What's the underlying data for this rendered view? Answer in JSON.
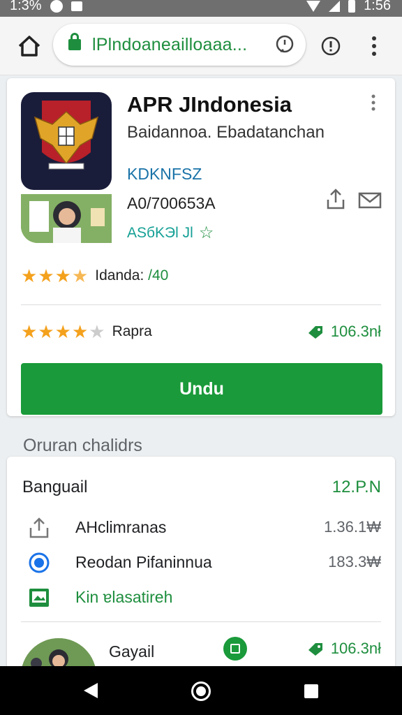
{
  "status_bar": {
    "time_left": "1:3%",
    "time_right": "1:56"
  },
  "browser": {
    "url": "lPlndoaneailloaaa...",
    "icons": [
      "home-icon",
      "lock-icon",
      "status-icon",
      "info-icon",
      "more-vert-icon"
    ]
  },
  "app": {
    "title": "APR JIndonesia",
    "developer": "Baidannoa. Ebadatanchan",
    "category": "KDKNFSZ",
    "version": "A0/700653A",
    "tags": "ASбKЭl Jl",
    "rating_label": "Idanda:",
    "rating_value": "/40",
    "rating_stars": 3.5,
    "rating2_label": "Rapra",
    "rating2_stars": 4.5,
    "size": "106.3nł",
    "install_label": "Undu"
  },
  "section": {
    "heading": "Oruran chalidrs",
    "list_title": "Banguail",
    "list_time": "12.P.N",
    "rows": [
      {
        "label": "AHclimranas",
        "amount": "1.36.1₩",
        "icon": "share-icon"
      },
      {
        "label": "Reodan Pifaninnua",
        "amount": "183.3₩",
        "icon": "radio-icon"
      },
      {
        "label": "Kin ɐlasatireh",
        "amount": "",
        "icon": "image-icon"
      }
    ],
    "bottom_name": "Gayail",
    "bottom_size": "106.3nł"
  },
  "colors": {
    "accent_green": "#1a9a3a",
    "star": "#f4a11d",
    "link_blue": "#1a73a8"
  }
}
